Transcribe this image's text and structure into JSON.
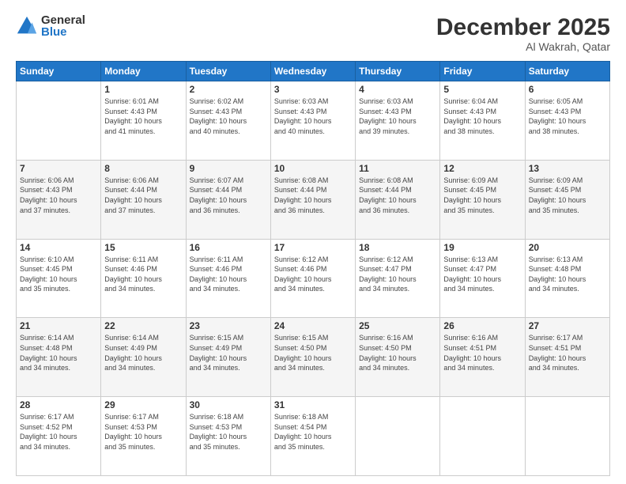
{
  "logo": {
    "general": "General",
    "blue": "Blue"
  },
  "title": "December 2025",
  "location": "Al Wakrah, Qatar",
  "header_days": [
    "Sunday",
    "Monday",
    "Tuesday",
    "Wednesday",
    "Thursday",
    "Friday",
    "Saturday"
  ],
  "weeks": [
    [
      {
        "day": "",
        "info": ""
      },
      {
        "day": "1",
        "info": "Sunrise: 6:01 AM\nSunset: 4:43 PM\nDaylight: 10 hours\nand 41 minutes."
      },
      {
        "day": "2",
        "info": "Sunrise: 6:02 AM\nSunset: 4:43 PM\nDaylight: 10 hours\nand 40 minutes."
      },
      {
        "day": "3",
        "info": "Sunrise: 6:03 AM\nSunset: 4:43 PM\nDaylight: 10 hours\nand 40 minutes."
      },
      {
        "day": "4",
        "info": "Sunrise: 6:03 AM\nSunset: 4:43 PM\nDaylight: 10 hours\nand 39 minutes."
      },
      {
        "day": "5",
        "info": "Sunrise: 6:04 AM\nSunset: 4:43 PM\nDaylight: 10 hours\nand 38 minutes."
      },
      {
        "day": "6",
        "info": "Sunrise: 6:05 AM\nSunset: 4:43 PM\nDaylight: 10 hours\nand 38 minutes."
      }
    ],
    [
      {
        "day": "7",
        "info": "Sunrise: 6:06 AM\nSunset: 4:43 PM\nDaylight: 10 hours\nand 37 minutes."
      },
      {
        "day": "8",
        "info": "Sunrise: 6:06 AM\nSunset: 4:44 PM\nDaylight: 10 hours\nand 37 minutes."
      },
      {
        "day": "9",
        "info": "Sunrise: 6:07 AM\nSunset: 4:44 PM\nDaylight: 10 hours\nand 36 minutes."
      },
      {
        "day": "10",
        "info": "Sunrise: 6:08 AM\nSunset: 4:44 PM\nDaylight: 10 hours\nand 36 minutes."
      },
      {
        "day": "11",
        "info": "Sunrise: 6:08 AM\nSunset: 4:44 PM\nDaylight: 10 hours\nand 36 minutes."
      },
      {
        "day": "12",
        "info": "Sunrise: 6:09 AM\nSunset: 4:45 PM\nDaylight: 10 hours\nand 35 minutes."
      },
      {
        "day": "13",
        "info": "Sunrise: 6:09 AM\nSunset: 4:45 PM\nDaylight: 10 hours\nand 35 minutes."
      }
    ],
    [
      {
        "day": "14",
        "info": "Sunrise: 6:10 AM\nSunset: 4:45 PM\nDaylight: 10 hours\nand 35 minutes."
      },
      {
        "day": "15",
        "info": "Sunrise: 6:11 AM\nSunset: 4:46 PM\nDaylight: 10 hours\nand 34 minutes."
      },
      {
        "day": "16",
        "info": "Sunrise: 6:11 AM\nSunset: 4:46 PM\nDaylight: 10 hours\nand 34 minutes."
      },
      {
        "day": "17",
        "info": "Sunrise: 6:12 AM\nSunset: 4:46 PM\nDaylight: 10 hours\nand 34 minutes."
      },
      {
        "day": "18",
        "info": "Sunrise: 6:12 AM\nSunset: 4:47 PM\nDaylight: 10 hours\nand 34 minutes."
      },
      {
        "day": "19",
        "info": "Sunrise: 6:13 AM\nSunset: 4:47 PM\nDaylight: 10 hours\nand 34 minutes."
      },
      {
        "day": "20",
        "info": "Sunrise: 6:13 AM\nSunset: 4:48 PM\nDaylight: 10 hours\nand 34 minutes."
      }
    ],
    [
      {
        "day": "21",
        "info": "Sunrise: 6:14 AM\nSunset: 4:48 PM\nDaylight: 10 hours\nand 34 minutes."
      },
      {
        "day": "22",
        "info": "Sunrise: 6:14 AM\nSunset: 4:49 PM\nDaylight: 10 hours\nand 34 minutes."
      },
      {
        "day": "23",
        "info": "Sunrise: 6:15 AM\nSunset: 4:49 PM\nDaylight: 10 hours\nand 34 minutes."
      },
      {
        "day": "24",
        "info": "Sunrise: 6:15 AM\nSunset: 4:50 PM\nDaylight: 10 hours\nand 34 minutes."
      },
      {
        "day": "25",
        "info": "Sunrise: 6:16 AM\nSunset: 4:50 PM\nDaylight: 10 hours\nand 34 minutes."
      },
      {
        "day": "26",
        "info": "Sunrise: 6:16 AM\nSunset: 4:51 PM\nDaylight: 10 hours\nand 34 minutes."
      },
      {
        "day": "27",
        "info": "Sunrise: 6:17 AM\nSunset: 4:51 PM\nDaylight: 10 hours\nand 34 minutes."
      }
    ],
    [
      {
        "day": "28",
        "info": "Sunrise: 6:17 AM\nSunset: 4:52 PM\nDaylight: 10 hours\nand 34 minutes."
      },
      {
        "day": "29",
        "info": "Sunrise: 6:17 AM\nSunset: 4:53 PM\nDaylight: 10 hours\nand 35 minutes."
      },
      {
        "day": "30",
        "info": "Sunrise: 6:18 AM\nSunset: 4:53 PM\nDaylight: 10 hours\nand 35 minutes."
      },
      {
        "day": "31",
        "info": "Sunrise: 6:18 AM\nSunset: 4:54 PM\nDaylight: 10 hours\nand 35 minutes."
      },
      {
        "day": "",
        "info": ""
      },
      {
        "day": "",
        "info": ""
      },
      {
        "day": "",
        "info": ""
      }
    ]
  ]
}
